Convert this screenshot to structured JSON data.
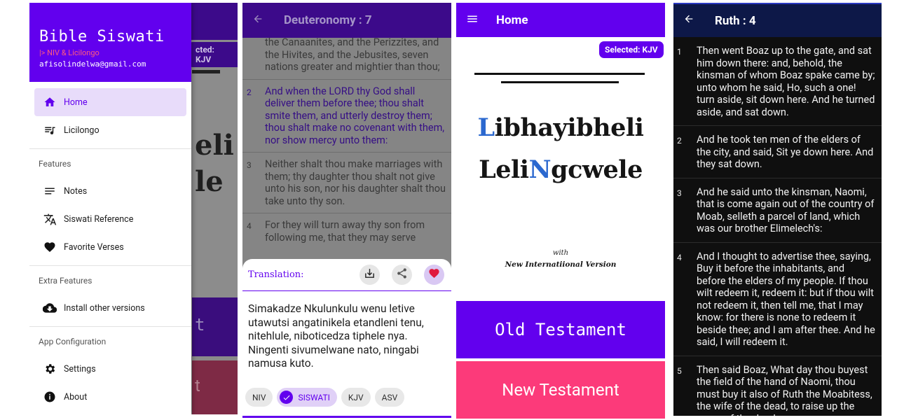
{
  "drawer_panel": {
    "under": {
      "chip": "cted: KJV",
      "big_lines": [
        "eli",
        "le"
      ],
      "btn1": "t",
      "btn2": "t"
    },
    "app_title": "Bible Siswati",
    "subtitle": "|> NIV & Licilongo",
    "email": "afisolindelwa@gmail.com",
    "items": [
      {
        "label": "Home",
        "icon": "home-icon"
      },
      {
        "label": "Licilongo",
        "icon": "playlist-icon"
      }
    ],
    "sections": [
      {
        "title": "Features",
        "items": [
          {
            "label": "Notes",
            "icon": "notes-icon"
          },
          {
            "label": "Siswati Reference",
            "icon": "translate-icon"
          },
          {
            "label": "Favorite Verses",
            "icon": "heart-icon"
          }
        ]
      },
      {
        "title": "Extra Features",
        "items": [
          {
            "label": "Install other versions",
            "icon": "cloud-download-icon"
          }
        ]
      },
      {
        "title": "App Configuration",
        "items": [
          {
            "label": "Settings",
            "icon": "gear-icon"
          },
          {
            "label": "About",
            "icon": "info-icon"
          }
        ]
      }
    ]
  },
  "chapter_panel": {
    "title": "Deuteronomy : 7",
    "verse1_tail": "the Canaanites, and the Perizzites, and the Hivites, and the Jebusites, seven nations greater and mightier than thou;",
    "verses": [
      {
        "num": "2",
        "text": "And when the LORD thy God shall deliver them before thee; thou shalt smite them, and utterly destroy them; thou shalt make no covenant with them, nor show mercy unto them:"
      },
      {
        "num": "3",
        "text": "Neither shalt thou make marriages with them; thy daughter thou shalt not give unto his son, nor his daughter shalt thou take unto thy son."
      },
      {
        "num": "4",
        "text": "For they will turn away thy son from following me, that they may serve"
      }
    ],
    "sheet": {
      "label": "Translation:",
      "text": "Simakadze Nkulunkulu wenu letive utawutsi angatinikela etandleni tenu, nitehlule, niboticedza tiphele nya. Ningenti sivumelwane nato, ningabi namusa kuto.",
      "chips": [
        "NIV",
        "SISWATI",
        "KJV",
        "ASV"
      ],
      "selected_chip": "SISWATI"
    }
  },
  "home_panel": {
    "title": "Home",
    "selected_badge": "Selected: KJV",
    "logo_line1": {
      "first": "L",
      "rest": "ibhayibheli"
    },
    "logo_line2": {
      "pre": "Leli",
      "accent": "N",
      "post": "gcwele"
    },
    "with": "with",
    "version_note": "New Internatiional Version",
    "old_testament": "Old Testament",
    "new_testament": "New Testament",
    "accent_color": "#6200ee",
    "pink_color": "#fc3a7a"
  },
  "ruth_panel": {
    "title": "Ruth : 4",
    "verses": [
      {
        "num": "1",
        "text": "Then went Boaz up to the gate, and sat him down there: and, behold, the kinsman of whom Boaz spake came by; unto whom he said, Ho, such a one! turn aside, sit down here. And he turned aside, and sat down."
      },
      {
        "num": "2",
        "text": "And he took ten men of the elders of the city, and said, Sit ye down here. And they sat down."
      },
      {
        "num": "3",
        "text": "And he said unto the kinsman, Naomi, that is come again out of the country of Moab, selleth a parcel of land, which was our brother Elimelech's:"
      },
      {
        "num": "4",
        "text": "And I thought to advertise thee, saying, Buy it before the inhabitants, and before the elders of my people. If thou wilt redeem it, redeem it: but if thou wilt not redeem it, then tell me, that I may know: for there is none to redeem it beside thee; and I am after thee. And he said, I will redeem it."
      },
      {
        "num": "5",
        "text": "Then said Boaz, What day thou buyest the field of the hand of Naomi, thou must buy it also of Ruth the Moabitess, the wife of the dead, to raise up the name of the dead upon"
      }
    ]
  }
}
